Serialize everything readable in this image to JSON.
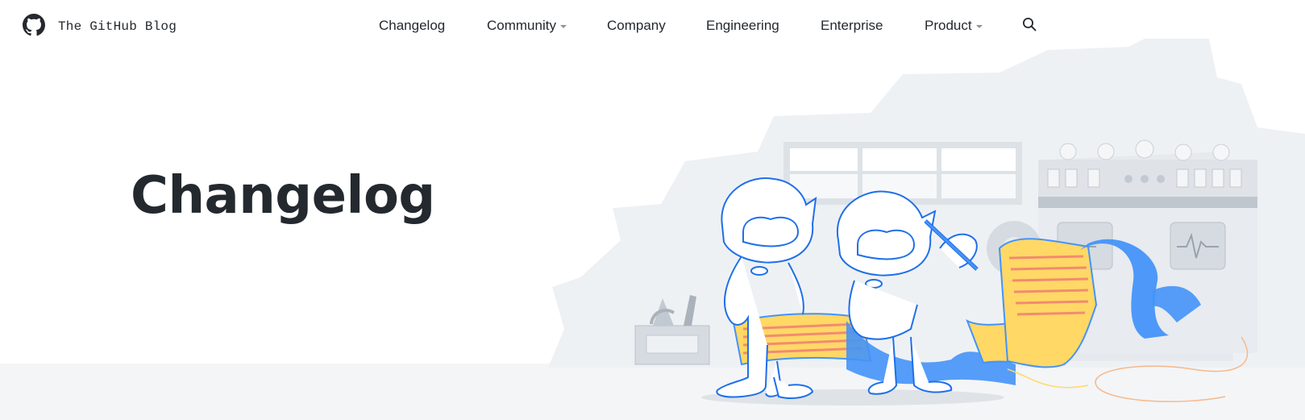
{
  "header": {
    "brand_name": "The GitHub Blog",
    "logo_icon": "github-octocat-icon"
  },
  "nav": {
    "items": [
      {
        "label": "Changelog",
        "dropdown": false
      },
      {
        "label": "Community",
        "dropdown": true
      },
      {
        "label": "Company",
        "dropdown": false
      },
      {
        "label": "Engineering",
        "dropdown": false
      },
      {
        "label": "Enterprise",
        "dropdown": false
      },
      {
        "label": "Product",
        "dropdown": true
      }
    ],
    "search_icon": "search-icon"
  },
  "hero": {
    "title": "Changelog",
    "illustration": "octocats-reading-changelog-scroll"
  },
  "colors": {
    "text": "#24292f",
    "accent_blue": "#4493f8",
    "illustration_line": "#1f6feb",
    "paper_yellow": "#ffd866",
    "paper_stripe": "#f28b70",
    "background_gray": "#eef1f4"
  }
}
